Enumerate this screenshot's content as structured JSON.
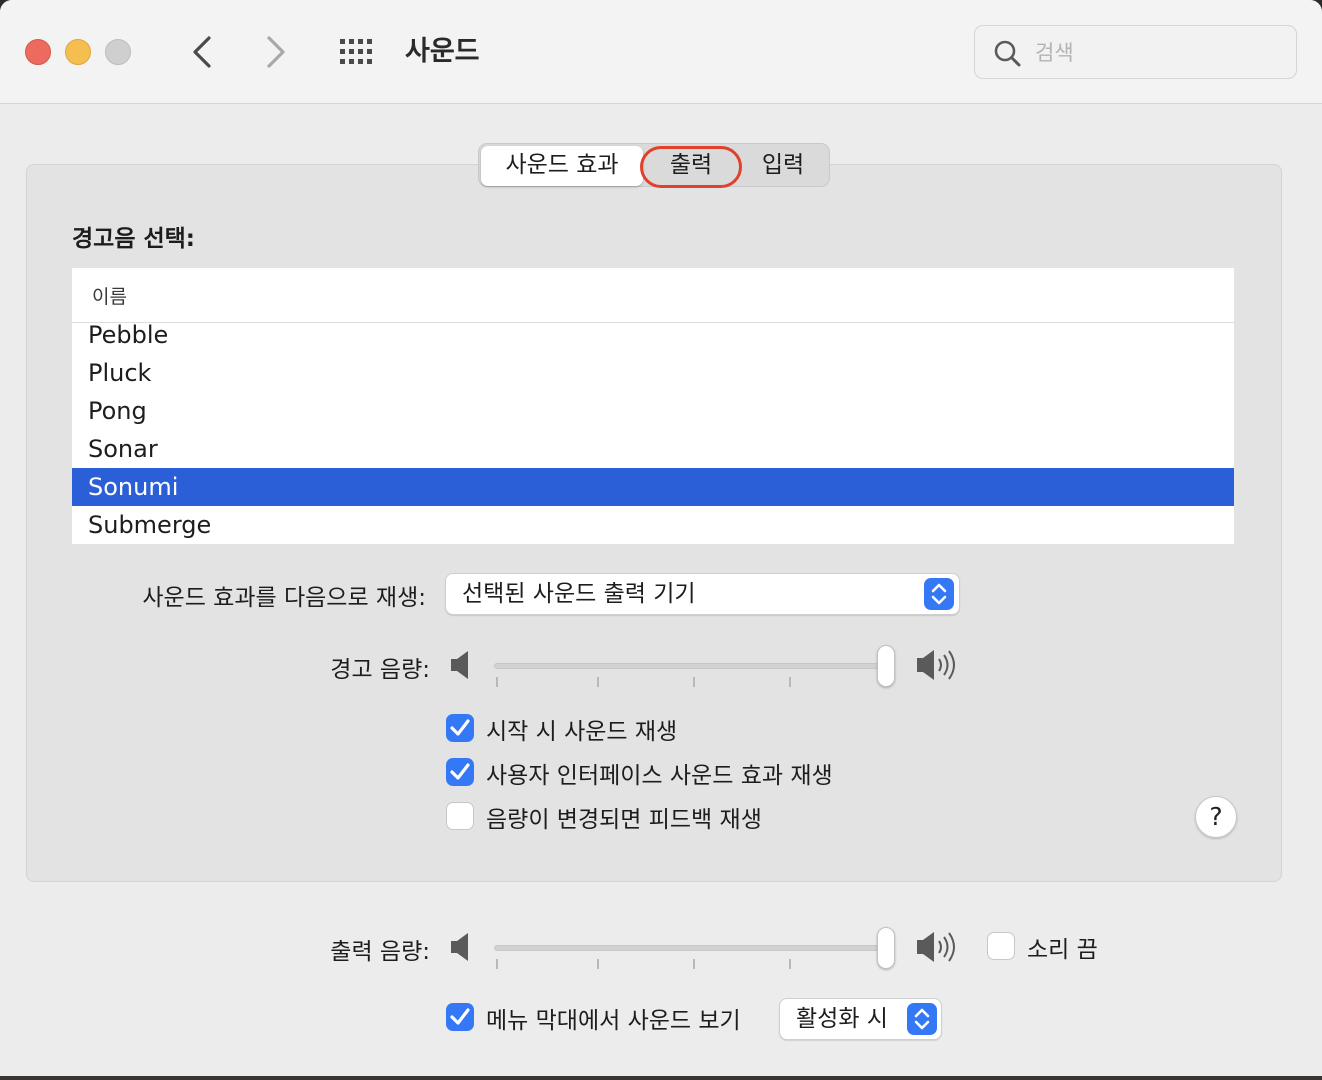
{
  "window": {
    "title": "사운드",
    "search_placeholder": "검색"
  },
  "tabs": [
    {
      "label": "사운드 효과",
      "selected": true
    },
    {
      "label": "출력",
      "selected": false
    },
    {
      "label": "입력",
      "selected": false
    }
  ],
  "alert": {
    "heading": "경고음 선택:",
    "column_header": "이름",
    "items": [
      "Pebble",
      "Pluck",
      "Pong",
      "Sonar",
      "Sonumi",
      "Submerge"
    ],
    "selected": "Sonumi"
  },
  "play_through": {
    "label": "사운드 효과를 다음으로 재생:",
    "value": "선택된 사운드 출력 기기"
  },
  "alert_volume": {
    "label": "경고 음량:",
    "level": 1.0
  },
  "checkboxes": [
    {
      "label": "시작 시 사운드 재생",
      "checked": true
    },
    {
      "label": "사용자 인터페이스 사운드 효과 재생",
      "checked": true
    },
    {
      "label": "음량이 변경되면 피드백 재생",
      "checked": false
    }
  ],
  "help_label": "?",
  "output_volume": {
    "label": "출력 음량:",
    "level": 1.0,
    "mute_label": "소리 끔",
    "mute_checked": false
  },
  "menubar": {
    "label": "메뉴 막대에서 사운드 보기",
    "checked": true,
    "value": "활성화 시"
  },
  "colors": {
    "accent": "#3478f6",
    "selection": "#2b5fd8",
    "highlight_ring": "#e0402c"
  }
}
